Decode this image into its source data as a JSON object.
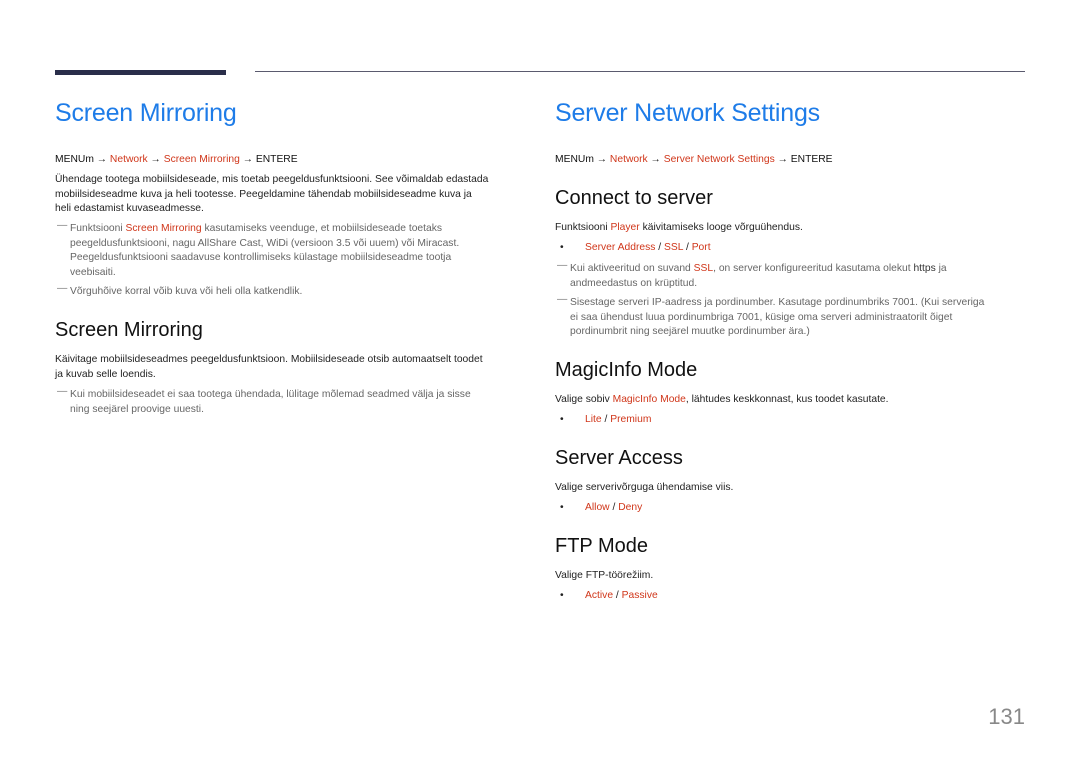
{
  "page_number": "131",
  "left": {
    "title": "Screen Mirroring",
    "menu_path": {
      "start": "MENUm → ",
      "item1": "Network",
      "sep1": " → ",
      "item2": "Screen Mirroring",
      "end": " → ENTERE"
    },
    "intro_lines": [
      "Ühendage tootega mobiilsideseade, mis toetab peegeldusfunktsiooni. See võimaldab edastada",
      "mobiilsideseadme kuva ja heli tootesse. Peegeldamine tähendab mobiilsideseadme kuva ja",
      "heli edastamist kuvaseadmesse."
    ],
    "note1": {
      "prefix": "Funktsiooni ",
      "highlight": "Screen Mirroring",
      "line1_rest": " kasutamiseks veenduge, et mobiilsideseade toetaks",
      "line2": "peegeldusfunktsiooni, nagu AllShare Cast, WiDi (versioon 3.5 või uuem) või Miracast.",
      "line3": "Peegeldusfunktsiooni saadavuse kontrollimiseks külastage mobiilsideseadme tootja",
      "line4": "veebisaiti."
    },
    "note2": "Võrguhõive korral võib kuva või heli olla katkendlik.",
    "section": {
      "heading": "Screen Mirroring",
      "body_lines": [
        "Käivitage mobiilsideseadmes peegeldusfunktsioon. Mobiilsideseade otsib automaatselt toodet",
        "ja kuvab selle loendis."
      ],
      "note_lines": [
        "Kui mobiilsideseadet ei saa tootega ühendada, lülitage mõlemad seadmed välja ja sisse",
        "ning seejärel proovige uuesti."
      ]
    },
    "note_dash": "―"
  },
  "right": {
    "title": "Server Network Settings",
    "menu_path": {
      "start": "MENUm → ",
      "item1": "Network",
      "sep1": " → ",
      "item2": "Server Network Settings",
      "end": " → ENTERE"
    },
    "connect": {
      "heading": "Connect to server",
      "body_prefix": "Funktsiooni ",
      "body_highlight": "Player",
      "body_rest": " käivitamiseks looge võrguühendus.",
      "options": [
        "Server Address",
        "SSL",
        "Port"
      ],
      "note1": {
        "prefix": "Kui aktiveeritud on suvand ",
        "highlight": "SSL",
        "rest": ", on server konfigureeritud kasutama olekut ",
        "bold": "https",
        "end": " ja",
        "line2": "andmeedastus on krüptitud."
      },
      "note2_lines": [
        "Sisestage serveri IP-aadress ja pordinumber. Kasutage pordinumbriks 7001. (Kui serveriga",
        "ei saa ühendust luua pordinumbriga 7001, küsige oma serveri administraatorilt õiget",
        "pordinumbrit ning seejärel muutke pordinumber ära.)"
      ]
    },
    "magicinfo": {
      "heading": "MagicInfo Mode",
      "body_prefix": "Valige sobiv ",
      "body_highlight": "MagicInfo Mode",
      "body_rest": ", lähtudes keskkonnast, kus toodet kasutate.",
      "options": [
        "Lite",
        "Premium"
      ]
    },
    "access": {
      "heading": "Server Access",
      "body": "Valige serverivõrguga ühendamise viis.",
      "options": [
        "Allow",
        "Deny"
      ]
    },
    "ftp": {
      "heading": "FTP Mode",
      "body": "Valige FTP-töörežiim.",
      "options": [
        "Active",
        "Passive"
      ]
    }
  },
  "bullet_char": "•",
  "option_sep": " / ",
  "colors": {
    "title_blue": "#1e7ce8",
    "highlight_red": "#d0361a",
    "bar_navy": "#2a2e4a"
  }
}
